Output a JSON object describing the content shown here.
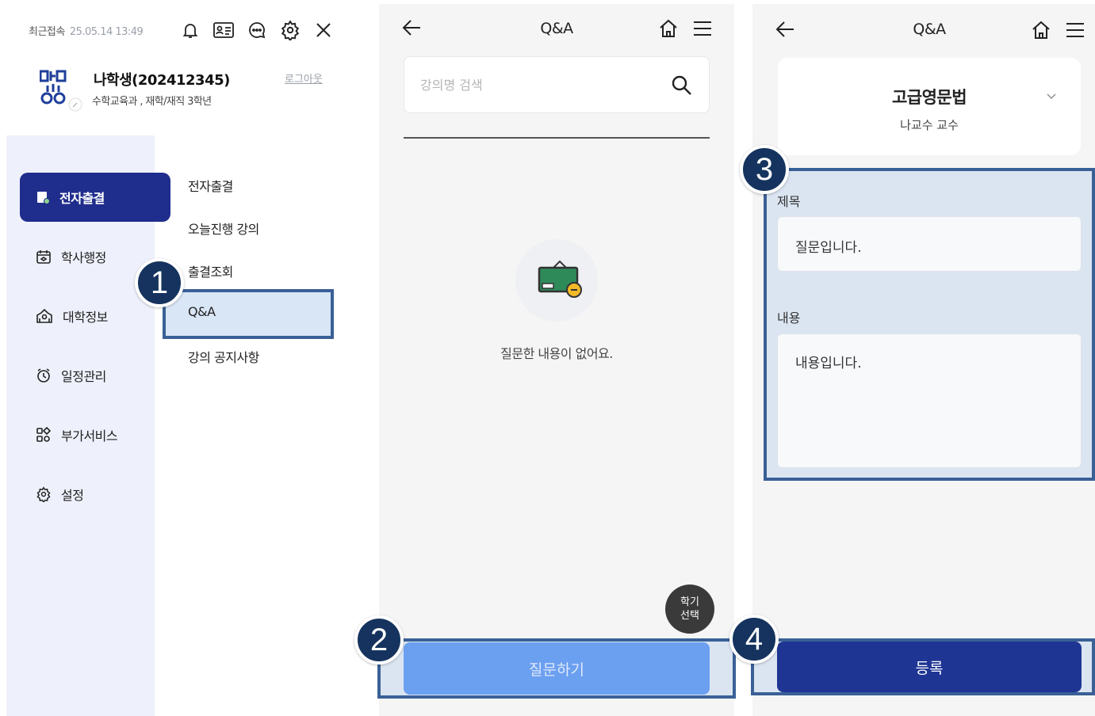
{
  "menu_panel": {
    "last_login_label": "최근접속",
    "last_login_time": "25.05.14 13:49",
    "top_icons": [
      "bell-icon",
      "id-card-icon",
      "chat-icon",
      "gear-icon",
      "close-icon"
    ],
    "user_name": "나학생(202412345)",
    "user_dept": "수학교육과 , 재학/재직 3학년",
    "logout_label": "로그아웃",
    "categories": [
      {
        "label": "전자출결",
        "icon": "attendance-icon",
        "active": true
      },
      {
        "label": "학사행정",
        "icon": "academic-icon",
        "active": false
      },
      {
        "label": "대학정보",
        "icon": "university-icon",
        "active": false
      },
      {
        "label": "일정관리",
        "icon": "alarm-icon",
        "active": false
      },
      {
        "label": "부가서비스",
        "icon": "services-icon",
        "active": false
      },
      {
        "label": "설정",
        "icon": "settings-icon",
        "active": false
      }
    ],
    "sub_items": [
      "전자출결",
      "오늘진행 강의",
      "출결조회",
      "Q&A",
      "강의 공지사항"
    ]
  },
  "qa_list_panel": {
    "title": "Q&A",
    "search_placeholder": "강의명 검색",
    "empty_message": "질문한 내용이 없어요.",
    "fab_line1": "학기",
    "fab_line2": "선택",
    "ask_button": "질문하기"
  },
  "qa_write_panel": {
    "title": "Q&A",
    "course_name": "고급영문법",
    "professor": "나교수 교수",
    "subject_label": "제목",
    "subject_value": "질문입니다.",
    "content_label": "내용",
    "content_value": "내용입니다.",
    "submit_button": "등록"
  },
  "steps": [
    "1",
    "2",
    "3",
    "4"
  ],
  "colors": {
    "primary": "#1f2d8c",
    "submit": "#1f3594",
    "ask_button": "#6b9ff0",
    "highlight_border": "#3a6096",
    "step_badge": "#15335e"
  }
}
